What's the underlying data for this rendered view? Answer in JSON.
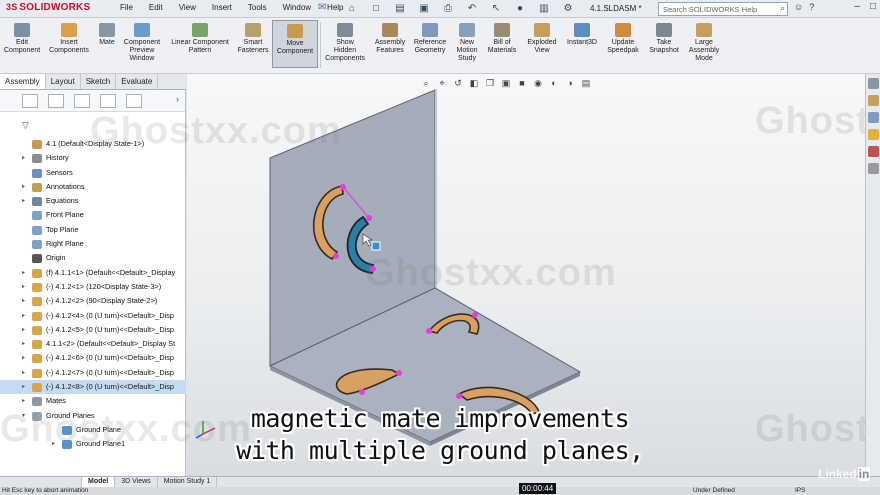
{
  "titlebar": {
    "brand": "SOLIDWORKS",
    "brand_prefix": "3S",
    "menus": [
      "File",
      "Edit",
      "View",
      "Insert",
      "Tools",
      "Window",
      "Help"
    ],
    "doc_title": "4.1.SLDASM *",
    "search_placeholder": "Search SOLIDWORKS Help"
  },
  "ribbon": {
    "commands": [
      {
        "label": "Edit\nComponent",
        "icon": "edit-component-icon"
      },
      {
        "label": "Insert\nComponents",
        "icon": "insert-components-icon"
      },
      {
        "label": "Mate",
        "icon": "mate-icon"
      },
      {
        "label": "Component\nPreview\nWindow",
        "icon": "preview-window-icon"
      },
      {
        "label": "Linear Component\nPattern",
        "icon": "linear-pattern-icon"
      },
      {
        "label": "Smart\nFasteners",
        "icon": "smart-fasteners-icon"
      },
      {
        "label": "Move\nComponent",
        "icon": "move-component-icon"
      },
      {
        "label": "Show\nHidden\nComponents",
        "icon": "show-hidden-icon"
      },
      {
        "label": "Assembly\nFeatures",
        "icon": "assembly-features-icon"
      },
      {
        "label": "Reference\nGeometry",
        "icon": "reference-geometry-icon"
      },
      {
        "label": "New\nMotion\nStudy",
        "icon": "motion-study-icon"
      },
      {
        "label": "Bill of\nMaterials",
        "icon": "bom-icon"
      },
      {
        "label": "Exploded\nView",
        "icon": "exploded-view-icon"
      },
      {
        "label": "Instant3D",
        "icon": "instant3d-icon"
      },
      {
        "label": "Update\nSpeedpak",
        "icon": "speedpak-icon"
      },
      {
        "label": "Take\nSnapshot",
        "icon": "snapshot-icon"
      },
      {
        "label": "Large\nAssembly\nMode",
        "icon": "large-assembly-icon"
      }
    ]
  },
  "tabs": [
    "Assembly",
    "Layout",
    "Sketch",
    "Evaluate"
  ],
  "tree": [
    {
      "label": "4.1  (Default<Display State-1>)",
      "icon": "assembly-icon",
      "level": 0,
      "arrow": ""
    },
    {
      "label": "History",
      "icon": "history-icon",
      "level": 1,
      "arrow": "▸"
    },
    {
      "label": "Sensors",
      "icon": "sensors-icon",
      "level": 1,
      "arrow": ""
    },
    {
      "label": "Annotations",
      "icon": "annotations-icon",
      "level": 1,
      "arrow": "▸"
    },
    {
      "label": "Equations",
      "icon": "equations-icon",
      "level": 1,
      "arrow": "▸"
    },
    {
      "label": "Front Plane",
      "icon": "plane-icon",
      "level": 1,
      "arrow": ""
    },
    {
      "label": "Top Plane",
      "icon": "plane-icon",
      "level": 1,
      "arrow": ""
    },
    {
      "label": "Right Plane",
      "icon": "plane-icon",
      "level": 1,
      "arrow": ""
    },
    {
      "label": "Origin",
      "icon": "origin-icon",
      "level": 1,
      "arrow": ""
    },
    {
      "label": "(f) 4.1.1<1> (Default<<Default>_Display",
      "icon": "part-icon",
      "level": 1,
      "arrow": "▸"
    },
    {
      "label": "(-) 4.1.2<1> (120<Display State-3>)",
      "icon": "part-icon",
      "level": 1,
      "arrow": "▸"
    },
    {
      "label": "(-) 4.1.2<2> (90<Display State-2>)",
      "icon": "part-icon",
      "level": 1,
      "arrow": "▸"
    },
    {
      "label": "(-) 4.1.2<4> (0 (U turn)<<Default>_Disp",
      "icon": "part-icon",
      "level": 1,
      "arrow": "▸"
    },
    {
      "label": "(-) 4.1.2<5> (0 (U turn)<<Default>_Disp",
      "icon": "part-icon",
      "level": 1,
      "arrow": "▸"
    },
    {
      "label": "4.1.1<2> (Default<<Default>_Display St",
      "icon": "part-icon",
      "level": 1,
      "arrow": "▸"
    },
    {
      "label": "(-) 4.1.2<6> (0 (U turn)<<Default>_Disp",
      "icon": "part-icon",
      "level": 1,
      "arrow": "▸"
    },
    {
      "label": "(-) 4.1.2<7> (0 (U turn)<<Default>_Disp",
      "icon": "part-icon",
      "level": 1,
      "arrow": "▸"
    },
    {
      "label": "(-) 4.1.2<8> (0 (U turn)<<Default>_Disp",
      "icon": "part-icon",
      "level": 1,
      "arrow": "▸",
      "selected": true
    },
    {
      "label": "Mates",
      "icon": "mates-icon",
      "level": 1,
      "arrow": "▸"
    },
    {
      "label": "Ground Planes",
      "icon": "ground-planes-icon",
      "level": 1,
      "arrow": "▾"
    },
    {
      "label": "Ground Plane",
      "icon": "ground-plane-icon",
      "level": 2,
      "arrow": ""
    },
    {
      "label": "Ground Plane1",
      "icon": "ground-plane-icon",
      "level": 2,
      "arrow": "▸"
    }
  ],
  "watermark": "Ghostxx.com",
  "subtitle": [
    "magnetic mate improvements",
    "with multiple ground planes,"
  ],
  "bottom_tabs": [
    "Model",
    "3D Views",
    "Motion Study 1"
  ],
  "status": {
    "message": "Hit Esc key to abort animation",
    "timer": "00:00:44",
    "state": "Under Defined",
    "units": "IPS"
  },
  "brand_mark": "Linked",
  "brand_mark_in": "in",
  "colors": {
    "accent": "#c8102e",
    "selection": "#c5dbf3",
    "bracket": "#d9a064",
    "magnet": "#e040e0"
  }
}
